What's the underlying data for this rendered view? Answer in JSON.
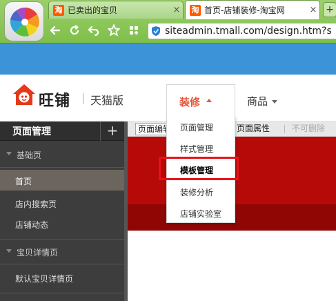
{
  "browser": {
    "tabs": [
      {
        "title": "已卖出的宝贝",
        "favicon": "淘",
        "active": false,
        "close": "×"
      },
      {
        "title": "首页-店铺装修-淘宝网",
        "favicon": "淘",
        "active": true,
        "close": "×"
      }
    ],
    "new_tab": "+",
    "url": "siteadmin.tmall.com/design.htm?s",
    "toolbar_icons": [
      "back-arrow-icon",
      "refresh-icon",
      "undo-icon",
      "star-icon",
      "apps-icon",
      "shield-icon"
    ],
    "chrome_color": "#8cc85a"
  },
  "header": {
    "brand_name": "旺铺",
    "brand_edition": "天猫版",
    "nav": [
      {
        "label": "装修",
        "active": true
      },
      {
        "label": "商品",
        "active": false
      }
    ],
    "accent_color": "#e4573a"
  },
  "dropdown": {
    "items": [
      {
        "label": "页面管理"
      },
      {
        "label": "样式管理"
      },
      {
        "label": "模板管理",
        "highlighted": true
      },
      {
        "label": "装修分析"
      },
      {
        "label": "店铺实验室"
      }
    ],
    "highlight_color": "#e8121a"
  },
  "sidebar": {
    "title": "页面管理",
    "add_label": "+",
    "groups": [
      {
        "label": "基础页",
        "items": [
          "首页",
          "店内搜索页",
          "店铺动态"
        ],
        "selected": "首页"
      },
      {
        "label": "宝贝详情页",
        "items": [
          "默认宝贝详情页"
        ]
      }
    ]
  },
  "content_toolbar": {
    "edit_label": "页面编辑",
    "props_label": "页面属性",
    "nodelete_label": "不可删除"
  },
  "canvas": {
    "banner_color": "#b50a08"
  }
}
